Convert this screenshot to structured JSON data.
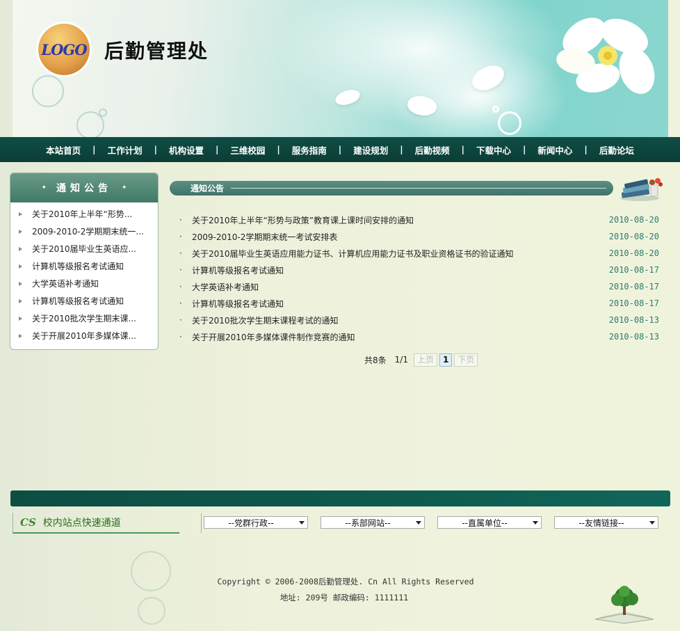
{
  "banner": {
    "logo_text": "LOGO",
    "site_title": "后勤管理处"
  },
  "nav": {
    "items": [
      "本站首页",
      "工作计划",
      "机构设置",
      "三维校园",
      "服务指南",
      "建设规划",
      "后勤视频",
      "下载中心",
      "新闻中心",
      "后勤论坛"
    ],
    "separator": "|"
  },
  "sidebar": {
    "title": "通知公告",
    "items": [
      "关于2010年上半年“形势...",
      "2009-2010-2学期期末统一...",
      "关于2010届毕业生英语应...",
      "计算机等级报名考试通知",
      "大学英语补考通知",
      "计算机等级报名考试通知",
      "关于2010批次学生期末课...",
      "关于开展2010年多媒体课..."
    ]
  },
  "main": {
    "title": "通知公告",
    "news": [
      {
        "title": "关于2010年上半年“形势与政策”教育课上课时间安排的通知",
        "date": "2010-08-20"
      },
      {
        "title": "2009-2010-2学期期末统一考试安排表",
        "date": "2010-08-20"
      },
      {
        "title": "关于2010届毕业生英语应用能力证书、计算机应用能力证书及职业资格证书的验证通知",
        "date": "2010-08-20"
      },
      {
        "title": "计算机等级报名考试通知",
        "date": "2010-08-17"
      },
      {
        "title": "大学英语补考通知",
        "date": "2010-08-17"
      },
      {
        "title": "计算机等级报名考试通知",
        "date": "2010-08-17"
      },
      {
        "title": "关于2010批次学生期末课程考试的通知",
        "date": "2010-08-13"
      },
      {
        "title": "关于开展2010年多媒体课件制作竞赛的通知",
        "date": "2010-08-13"
      }
    ],
    "bullet": "·",
    "pager": {
      "total": "共8条",
      "page_info": "1/1",
      "prev": "上页",
      "current": "1",
      "next": "下页"
    }
  },
  "footer": {
    "quick_icon": "CS",
    "quick_label": "校内站点快速通道",
    "selects": [
      "--党群行政--",
      "--系部网站--",
      "--直属单位--",
      "--友情链接--"
    ],
    "copyright": "Copyright ©  2006-2008后勤管理处. Cn All Rights Reserved",
    "address": "地址: 209号 邮政编码: 1111111"
  },
  "colors": {
    "nav_bg": "#0b3d35",
    "accent_green": "#3f7368",
    "date_color": "#2d7a6e"
  }
}
